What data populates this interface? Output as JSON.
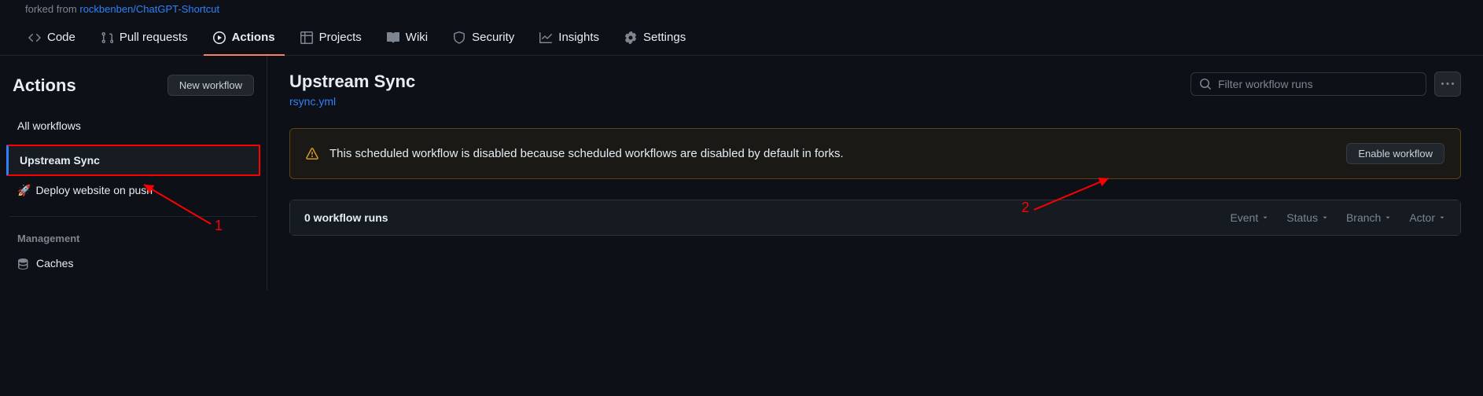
{
  "header": {
    "forked_prefix": "forked from ",
    "forked_link": "rockbenben/ChatGPT-Shortcut"
  },
  "nav": {
    "code": "Code",
    "pulls": "Pull requests",
    "actions": "Actions",
    "projects": "Projects",
    "wiki": "Wiki",
    "security": "Security",
    "insights": "Insights",
    "settings": "Settings"
  },
  "sidebar": {
    "title": "Actions",
    "new_workflow": "New workflow",
    "all_workflows": "All workflows",
    "upstream_sync": "Upstream Sync",
    "deploy": "Deploy website on push",
    "management": "Management",
    "caches": "Caches"
  },
  "content": {
    "title": "Upstream Sync",
    "file": "rsync.yml",
    "filter_placeholder": "Filter workflow runs",
    "alert": "This scheduled workflow is disabled because scheduled workflows are disabled by default in forks.",
    "enable_btn": "Enable workflow",
    "runs_count": "0 workflow runs",
    "filters": {
      "event": "Event",
      "status": "Status",
      "branch": "Branch",
      "actor": "Actor"
    }
  },
  "annotations": {
    "1": "1",
    "2": "2"
  }
}
